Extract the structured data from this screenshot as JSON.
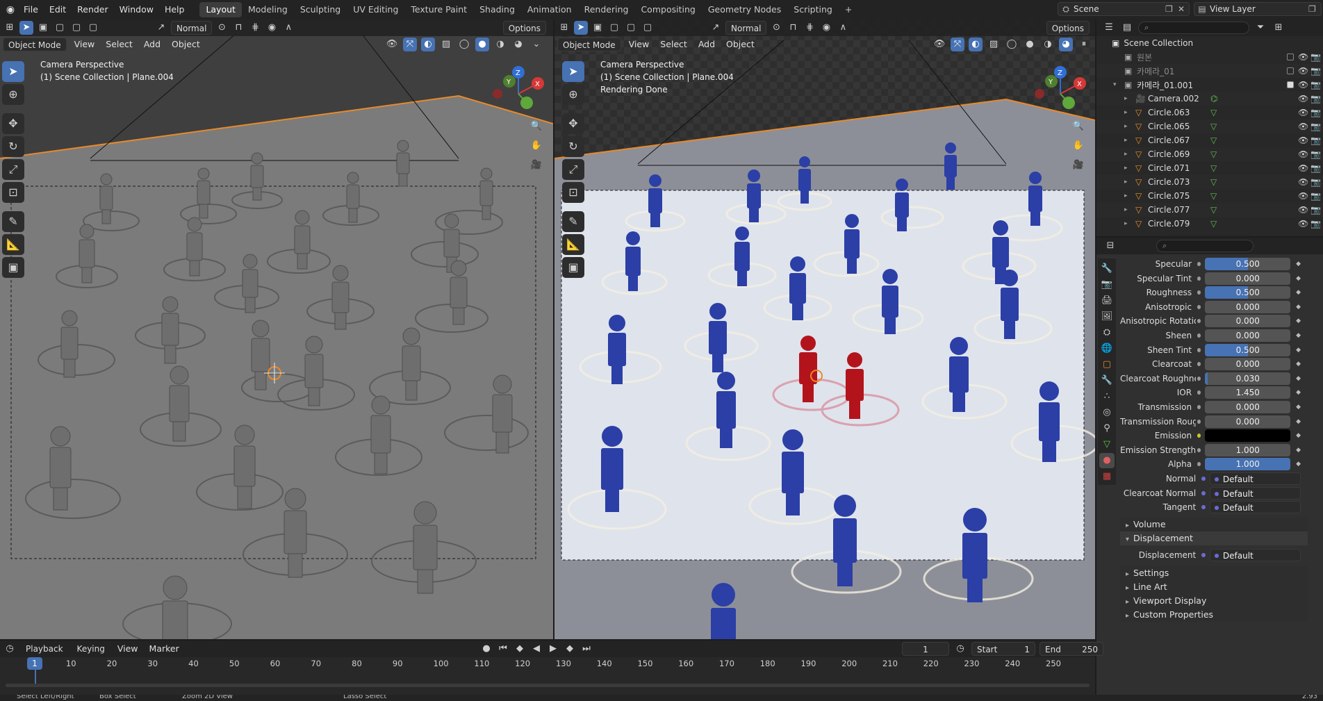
{
  "topbar": {
    "menus": [
      "File",
      "Edit",
      "Render",
      "Window",
      "Help"
    ],
    "workspaces": [
      "Layout",
      "Modeling",
      "Sculpting",
      "UV Editing",
      "Texture Paint",
      "Shading",
      "Animation",
      "Rendering",
      "Compositing",
      "Geometry Nodes",
      "Scripting"
    ],
    "active_workspace": "Layout",
    "add_tab": "+",
    "scene_name": "Scene",
    "view_layer_name": "View Layer"
  },
  "viewport_header": {
    "orientation": "Normal",
    "options": "Options",
    "mode": "Object Mode",
    "menus": [
      "View",
      "Select",
      "Add",
      "Object"
    ]
  },
  "left_viewport": {
    "line1": "Camera Perspective",
    "line2": "(1) Scene Collection | Plane.004",
    "line3": ""
  },
  "right_viewport": {
    "line1": "Camera Perspective",
    "line2": "(1) Scene Collection | Plane.004",
    "line3": "Rendering Done"
  },
  "gizmo": {
    "x": "X",
    "y": "Y",
    "z": "Z"
  },
  "outliner": {
    "title": "Scene Collection",
    "rows": [
      {
        "name": "원본",
        "indent": 1,
        "type": "collection"
      },
      {
        "name": "카메라_01",
        "indent": 1,
        "type": "collection"
      },
      {
        "name": "카메라_01.001",
        "indent": 1,
        "type": "collection",
        "expanded": true
      },
      {
        "name": "Camera.002",
        "indent": 2,
        "type": "camera"
      },
      {
        "name": "Circle.063",
        "indent": 2,
        "type": "mesh"
      },
      {
        "name": "Circle.065",
        "indent": 2,
        "type": "mesh"
      },
      {
        "name": "Circle.067",
        "indent": 2,
        "type": "mesh"
      },
      {
        "name": "Circle.069",
        "indent": 2,
        "type": "mesh"
      },
      {
        "name": "Circle.071",
        "indent": 2,
        "type": "mesh"
      },
      {
        "name": "Circle.073",
        "indent": 2,
        "type": "mesh"
      },
      {
        "name": "Circle.075",
        "indent": 2,
        "type": "mesh"
      },
      {
        "name": "Circle.077",
        "indent": 2,
        "type": "mesh"
      },
      {
        "name": "Circle.079",
        "indent": 2,
        "type": "mesh"
      }
    ]
  },
  "properties": {
    "rows": [
      {
        "label": "Specular",
        "value": "0.500",
        "fraction": 0.5
      },
      {
        "label": "Specular Tint",
        "value": "0.000",
        "fraction": 0
      },
      {
        "label": "Roughness",
        "value": "0.500",
        "fraction": 0.5
      },
      {
        "label": "Anisotropic",
        "value": "0.000",
        "fraction": 0
      },
      {
        "label": "Anisotropic Rotation",
        "value": "0.000",
        "fraction": 0
      },
      {
        "label": "Sheen",
        "value": "0.000",
        "fraction": 0
      },
      {
        "label": "Sheen Tint",
        "value": "0.500",
        "fraction": 0.5
      },
      {
        "label": "Clearcoat",
        "value": "0.000",
        "fraction": 0
      },
      {
        "label": "Clearcoat Roughnes",
        "value": "0.030",
        "fraction": 0.03
      },
      {
        "label": "IOR",
        "value": "1.450",
        "fraction": 0
      },
      {
        "label": "Transmission",
        "value": "0.000",
        "fraction": 0
      },
      {
        "label": "Transmission Roug...",
        "value": "0.000",
        "fraction": 0
      },
      {
        "label": "Emission",
        "value": "",
        "color": "#000000"
      },
      {
        "label": "Emission Strength",
        "value": "1.000",
        "fraction": 0
      },
      {
        "label": "Alpha",
        "value": "1.000",
        "fraction": 1
      },
      {
        "label": "Normal",
        "value": "Default",
        "link": true
      },
      {
        "label": "Clearcoat Normal",
        "value": "Default",
        "link": true
      },
      {
        "label": "Tangent",
        "value": "Default",
        "link": true
      }
    ],
    "panels": [
      {
        "label": "Volume",
        "open": false
      },
      {
        "label": "Displacement",
        "open": true
      }
    ],
    "displacement": {
      "label": "Displacement",
      "value": "Default"
    },
    "more_panels": [
      "Settings",
      "Line Art",
      "Viewport Display",
      "Custom Properties"
    ]
  },
  "timeline": {
    "menus": [
      "Playback",
      "Keying",
      "View",
      "Marker"
    ],
    "current_frame": "1",
    "start_label": "Start",
    "start": "1",
    "end_label": "End",
    "end": "250",
    "ticks": [
      "1",
      "10",
      "20",
      "30",
      "40",
      "50",
      "60",
      "70",
      "80",
      "90",
      "100",
      "110",
      "120",
      "130",
      "140",
      "150",
      "160",
      "170",
      "180",
      "190",
      "200",
      "210",
      "220",
      "230",
      "240",
      "250"
    ]
  },
  "statusbar": {
    "items": [
      "Select Left/Right",
      "Box Select",
      "Zoom 2D View",
      "Lasso Select"
    ],
    "version": "2.93"
  },
  "colors": {
    "accent": "#4772b3",
    "figure_blue": "#2b3fa6",
    "figure_red": "#b3141c",
    "selection_orange": "#e88a2a"
  }
}
